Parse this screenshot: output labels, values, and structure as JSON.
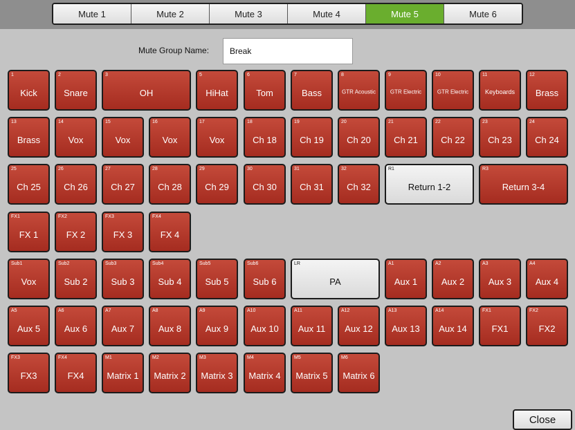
{
  "tabs": [
    "Mute 1",
    "Mute 2",
    "Mute 3",
    "Mute 4",
    "Mute 5",
    "Mute 6"
  ],
  "active_tab": 4,
  "group_name_label": "Mute Group Name:",
  "group_name_value": "Break",
  "close_label": "Close",
  "colors": {
    "muted": "#b13a2c",
    "unmuted": "#e6e6e6",
    "active_tab": "#6aae2e"
  },
  "channels": [
    {
      "num": "1",
      "label": "Kick",
      "row": 0,
      "col": 0,
      "span": 1
    },
    {
      "num": "2",
      "label": "Snare",
      "row": 0,
      "col": 1,
      "span": 1
    },
    {
      "num": "3",
      "label": "OH",
      "row": 0,
      "col": 2,
      "span": 2
    },
    {
      "num": "5",
      "label": "HiHat",
      "row": 0,
      "col": 4,
      "span": 1
    },
    {
      "num": "6",
      "label": "Tom",
      "row": 0,
      "col": 5,
      "span": 1
    },
    {
      "num": "7",
      "label": "Bass",
      "row": 0,
      "col": 6,
      "span": 1
    },
    {
      "num": "8",
      "label": "GTR Acoustic",
      "row": 0,
      "col": 7,
      "span": 1,
      "size": "sm"
    },
    {
      "num": "9",
      "label": "GTR Electric",
      "row": 0,
      "col": 8,
      "span": 1,
      "size": "sm"
    },
    {
      "num": "10",
      "label": "GTR Electric",
      "row": 0,
      "col": 9,
      "span": 1,
      "size": "sm"
    },
    {
      "num": "11",
      "label": "Keyboards",
      "row": 0,
      "col": 10,
      "span": 1,
      "size": "md"
    },
    {
      "num": "12",
      "label": "Brass",
      "row": 0,
      "col": 11,
      "span": 1
    },
    {
      "num": "13",
      "label": "Brass",
      "row": 1,
      "col": 0,
      "span": 1
    },
    {
      "num": "14",
      "label": "Vox",
      "row": 1,
      "col": 1,
      "span": 1
    },
    {
      "num": "15",
      "label": "Vox",
      "row": 1,
      "col": 2,
      "span": 1
    },
    {
      "num": "16",
      "label": "Vox",
      "row": 1,
      "col": 3,
      "span": 1
    },
    {
      "num": "17",
      "label": "Vox",
      "row": 1,
      "col": 4,
      "span": 1
    },
    {
      "num": "18",
      "label": "Ch 18",
      "row": 1,
      "col": 5,
      "span": 1
    },
    {
      "num": "19",
      "label": "Ch 19",
      "row": 1,
      "col": 6,
      "span": 1
    },
    {
      "num": "20",
      "label": "Ch 20",
      "row": 1,
      "col": 7,
      "span": 1
    },
    {
      "num": "21",
      "label": "Ch 21",
      "row": 1,
      "col": 8,
      "span": 1
    },
    {
      "num": "22",
      "label": "Ch 22",
      "row": 1,
      "col": 9,
      "span": 1
    },
    {
      "num": "23",
      "label": "Ch 23",
      "row": 1,
      "col": 10,
      "span": 1
    },
    {
      "num": "24",
      "label": "Ch 24",
      "row": 1,
      "col": 11,
      "span": 1
    },
    {
      "num": "25",
      "label": "Ch 25",
      "row": 2,
      "col": 0,
      "span": 1
    },
    {
      "num": "26",
      "label": "Ch 26",
      "row": 2,
      "col": 1,
      "span": 1
    },
    {
      "num": "27",
      "label": "Ch 27",
      "row": 2,
      "col": 2,
      "span": 1
    },
    {
      "num": "28",
      "label": "Ch 28",
      "row": 2,
      "col": 3,
      "span": 1
    },
    {
      "num": "29",
      "label": "Ch 29",
      "row": 2,
      "col": 4,
      "span": 1
    },
    {
      "num": "30",
      "label": "Ch 30",
      "row": 2,
      "col": 5,
      "span": 1
    },
    {
      "num": "31",
      "label": "Ch 31",
      "row": 2,
      "col": 6,
      "span": 1
    },
    {
      "num": "32",
      "label": "Ch 32",
      "row": 2,
      "col": 7,
      "span": 1
    },
    {
      "num": "R1",
      "label": "Return 1-2",
      "row": 2,
      "col": 8,
      "span": 2,
      "muted": false
    },
    {
      "num": "R3",
      "label": "Return 3-4",
      "row": 2,
      "col": 10,
      "span": 2
    },
    {
      "num": "FX1",
      "label": "FX 1",
      "row": 3,
      "col": 0,
      "span": 1
    },
    {
      "num": "FX2",
      "label": "FX 2",
      "row": 3,
      "col": 1,
      "span": 1
    },
    {
      "num": "FX3",
      "label": "FX 3",
      "row": 3,
      "col": 2,
      "span": 1
    },
    {
      "num": "FX4",
      "label": "FX 4",
      "row": 3,
      "col": 3,
      "span": 1
    },
    {
      "num": "Sub1",
      "label": "Vox",
      "row": 4,
      "col": 0,
      "span": 1
    },
    {
      "num": "Sub2",
      "label": "Sub 2",
      "row": 4,
      "col": 1,
      "span": 1
    },
    {
      "num": "Sub3",
      "label": "Sub 3",
      "row": 4,
      "col": 2,
      "span": 1
    },
    {
      "num": "Sub4",
      "label": "Sub 4",
      "row": 4,
      "col": 3,
      "span": 1
    },
    {
      "num": "Sub5",
      "label": "Sub 5",
      "row": 4,
      "col": 4,
      "span": 1
    },
    {
      "num": "Sub6",
      "label": "Sub 6",
      "row": 4,
      "col": 5,
      "span": 1
    },
    {
      "num": "LR",
      "label": "PA",
      "row": 4,
      "col": 6,
      "span": 2,
      "muted": false
    },
    {
      "num": "A1",
      "label": "Aux 1",
      "row": 4,
      "col": 8,
      "span": 1
    },
    {
      "num": "A2",
      "label": "Aux 2",
      "row": 4,
      "col": 9,
      "span": 1
    },
    {
      "num": "A3",
      "label": "Aux 3",
      "row": 4,
      "col": 10,
      "span": 1
    },
    {
      "num": "A4",
      "label": "Aux 4",
      "row": 4,
      "col": 11,
      "span": 1
    },
    {
      "num": "A5",
      "label": "Aux 5",
      "row": 5,
      "col": 0,
      "span": 1
    },
    {
      "num": "A6",
      "label": "Aux 6",
      "row": 5,
      "col": 1,
      "span": 1
    },
    {
      "num": "A7",
      "label": "Aux 7",
      "row": 5,
      "col": 2,
      "span": 1
    },
    {
      "num": "A8",
      "label": "Aux 8",
      "row": 5,
      "col": 3,
      "span": 1
    },
    {
      "num": "A9",
      "label": "Aux 9",
      "row": 5,
      "col": 4,
      "span": 1
    },
    {
      "num": "A10",
      "label": "Aux 10",
      "row": 5,
      "col": 5,
      "span": 1
    },
    {
      "num": "A11",
      "label": "Aux 11",
      "row": 5,
      "col": 6,
      "span": 1
    },
    {
      "num": "A12",
      "label": "Aux 12",
      "row": 5,
      "col": 7,
      "span": 1
    },
    {
      "num": "A13",
      "label": "Aux 13",
      "row": 5,
      "col": 8,
      "span": 1
    },
    {
      "num": "A14",
      "label": "Aux 14",
      "row": 5,
      "col": 9,
      "span": 1
    },
    {
      "num": "FX1",
      "label": "FX1",
      "row": 5,
      "col": 10,
      "span": 1
    },
    {
      "num": "FX2",
      "label": "FX2",
      "row": 5,
      "col": 11,
      "span": 1
    },
    {
      "num": "FX3",
      "label": "FX3",
      "row": 6,
      "col": 0,
      "span": 1
    },
    {
      "num": "FX4",
      "label": "FX4",
      "row": 6,
      "col": 1,
      "span": 1
    },
    {
      "num": "M1",
      "label": "Matrix 1",
      "row": 6,
      "col": 2,
      "span": 1
    },
    {
      "num": "M2",
      "label": "Matrix 2",
      "row": 6,
      "col": 3,
      "span": 1
    },
    {
      "num": "M3",
      "label": "Matrix 3",
      "row": 6,
      "col": 4,
      "span": 1
    },
    {
      "num": "M4",
      "label": "Matrix 4",
      "row": 6,
      "col": 5,
      "span": 1
    },
    {
      "num": "M5",
      "label": "Matrix 5",
      "row": 6,
      "col": 6,
      "span": 1
    },
    {
      "num": "M6",
      "label": "Matrix 6",
      "row": 6,
      "col": 7,
      "span": 1
    }
  ]
}
